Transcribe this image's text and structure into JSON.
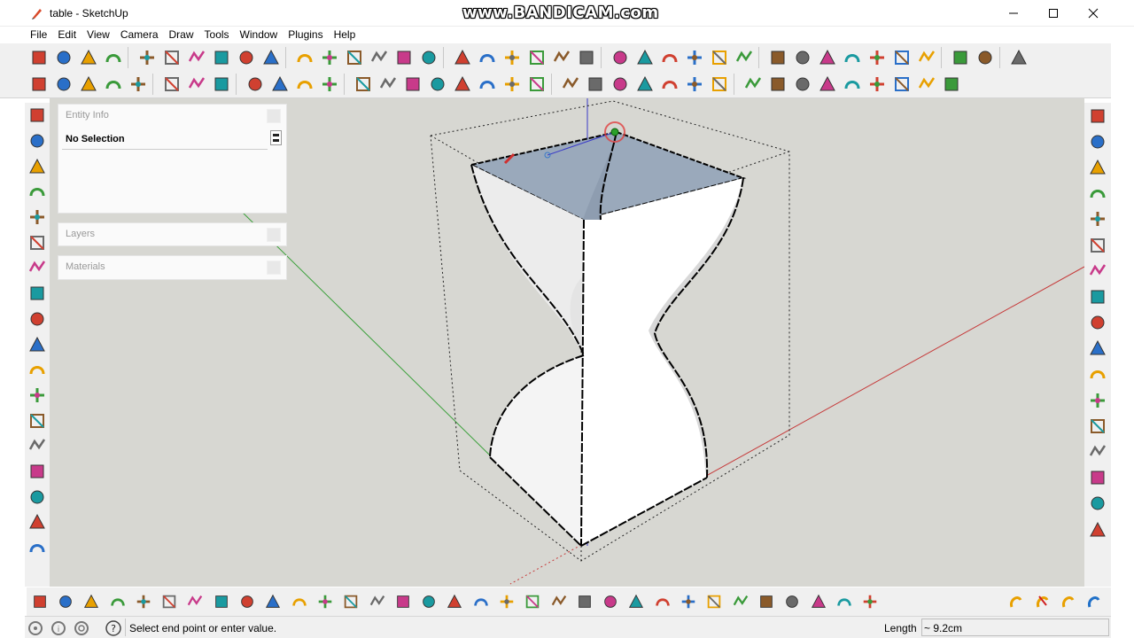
{
  "window": {
    "title": "table - SketchUp",
    "watermark": "www.BANDICAM.com"
  },
  "menu": [
    "File",
    "Edit",
    "View",
    "Camera",
    "Draw",
    "Tools",
    "Window",
    "Plugins",
    "Help"
  ],
  "panels": {
    "entity_info": {
      "title": "Entity Info",
      "selection": "No Selection"
    },
    "layers": {
      "title": "Layers"
    },
    "materials": {
      "title": "Materials"
    }
  },
  "status": {
    "message": "Select end point or enter value.",
    "measurement_label": "Length",
    "measurement_value": "~ 9.2cm"
  },
  "colors": {
    "viewport_bg": "#d7d7d2",
    "red_axis": "#c63a3a",
    "green_axis": "#3aa03a",
    "blue_axis": "#3a3ac8",
    "top_face": "#9aa9bb",
    "side_face": "#ffffff",
    "edge": "#000000",
    "cursor_ring": "#e04040"
  },
  "icons": {
    "toolbar_row1": [
      "select-icon",
      "eraser-icon",
      "paint-bucket-icon",
      "eraser-pink-icon",
      "rectangle-icon",
      "pencil-icon",
      "circle-icon",
      "arc-icon",
      "polygon-icon",
      "freehand-icon",
      "move-icon",
      "push-pull-icon",
      "rotate-icon",
      "follow-me-icon",
      "scale-icon",
      "offset-icon",
      "tape-measure-icon",
      "dimension-icon",
      "protractor-icon",
      "text-icon",
      "axes-icon",
      "3d-text-icon",
      "iso-view-icon",
      "top-view-icon",
      "front-view-icon",
      "right-view-icon",
      "back-view-icon",
      "left-view-icon",
      "xray-icon",
      "wireframe-icon",
      "hidden-line-icon",
      "shaded-icon",
      "shaded-texture-icon",
      "monochrome-icon",
      "orbit-style-icon",
      "section-plane-icon",
      "section-display-icon",
      "geo-location-icon"
    ],
    "toolbar_row2": [
      "fredo-icon",
      "curviloft-icon",
      "pencil-tool-icon",
      "joint-push-pull-icon",
      "wand-icon",
      "extrude-icon",
      "loft-icon",
      "skin-icon",
      "shell-icon",
      "magnet-icon",
      "soften-icon",
      "component-icon",
      "up-arrow-icon",
      "split-arrows-icon",
      "down-arrows-icon",
      "align-icon",
      "weld-icon",
      "undo-icon",
      "redo-icon",
      "clean-icon",
      "stack-sa-icon",
      "stack-aj-icon",
      "stack-ar-icon",
      "stack-av-icon",
      "stack-an-icon",
      "stack-ax-icon",
      "stack-af-icon",
      "orbit-icon",
      "pan-icon",
      "zoom-icon",
      "zoom-window-icon",
      "zoom-extents-icon",
      "previous-view-icon",
      "next-view-icon",
      "look-around-icon",
      "walk-icon"
    ],
    "left_tools": [
      "arc-blue-icon",
      "line-blue-icon",
      "curve-icon",
      "spline-icon",
      "line-tool-icon",
      "arc-green-icon",
      "rectangle-blue-icon",
      "circle-blue-icon",
      "arc-red-icon",
      "zigzag-icon",
      "hook-icon",
      "arc-small-icon",
      "arc-large-red-icon",
      "polyline-icon",
      "polygon-blue-icon",
      "wrench-icon",
      "ellipse-icon",
      "triangle-icon"
    ],
    "right_tools": [
      "layers-panel-icon",
      "blue-arc-icon",
      "peak-icon",
      "line-red-icon",
      "wave-icon",
      "sloped-line-icon",
      "slope-x-icon",
      "slope-y-icon",
      "slope-z-icon",
      "diamond-outline-icon",
      "diamond-green-icon",
      "box-icon",
      "boxes-icon",
      "diamond-red-outline-icon",
      "diamond-red-icon",
      "box-red-icon",
      "boxes-red-icon"
    ],
    "bottom_tools": [
      "b-1-icon",
      "b-2-icon",
      "b-3-icon",
      "b-4-icon",
      "b-5-icon",
      "b-6-icon",
      "b-7-icon",
      "b-8-icon",
      "b-9-icon",
      "b-10-icon",
      "b-11-icon",
      "b-12-icon",
      "b-13-icon",
      "b-14-icon",
      "b-15-icon",
      "b-16-icon",
      "b-17-icon",
      "b-18-icon",
      "b-19-icon",
      "b-20-icon",
      "b-21-icon",
      "b-22-icon",
      "b-23-icon",
      "b-24-icon",
      "b-25-icon",
      "b-26-icon",
      "b-27-icon",
      "b-28-icon",
      "b-29-icon",
      "b-30-icon",
      "b-31-icon",
      "b-32-icon",
      "b-33-icon"
    ]
  }
}
